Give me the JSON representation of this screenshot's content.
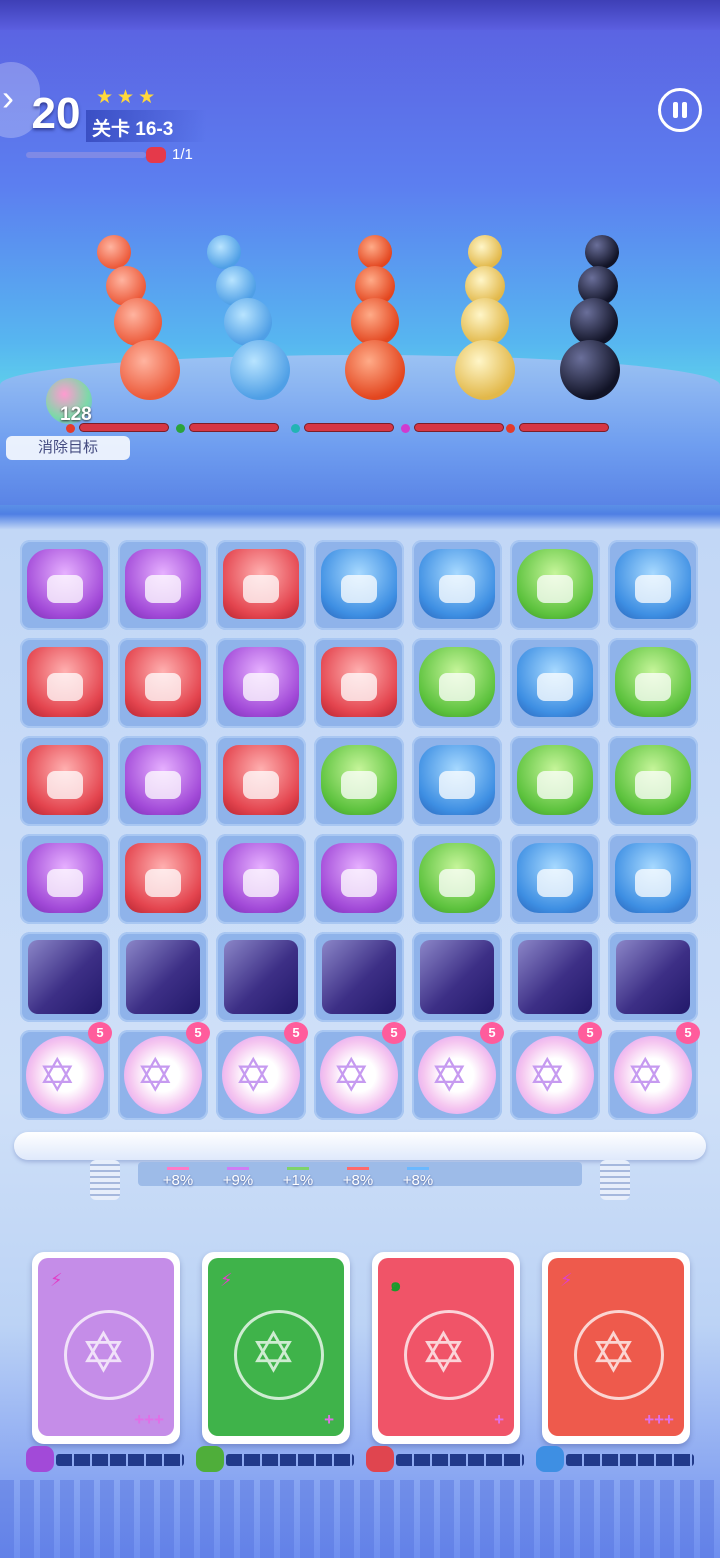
{
  "hud": {
    "moves_left": "20",
    "stars": "★★★",
    "level_label": "关卡 16-3",
    "target_progress": "1/1",
    "back_symbol": "›",
    "objective_orb_value": "128",
    "objective_button": "消除目标"
  },
  "enemies": {
    "columns": [
      "red-bird",
      "blue-jelly",
      "red-crab",
      "gold-spiky-shell",
      "black-bomb"
    ],
    "column_element_icons": [
      "fire",
      "wind",
      "ice",
      "lightning",
      "fire"
    ],
    "rows": 4
  },
  "board": {
    "rows": [
      [
        "purple",
        "purple",
        "red",
        "blue",
        "blue",
        "green",
        "blue"
      ],
      [
        "red",
        "red",
        "purple",
        "red",
        "green",
        "blue",
        "green"
      ],
      [
        "red",
        "purple",
        "red",
        "green",
        "blue",
        "green",
        "green"
      ],
      [
        "purple",
        "red",
        "purple",
        "purple",
        "green",
        "blue",
        "blue"
      ],
      [
        "dark",
        "dark",
        "dark",
        "dark",
        "dark",
        "dark",
        "dark"
      ],
      [
        "star",
        "star",
        "star",
        "star",
        "star",
        "star",
        "star"
      ]
    ],
    "star_badge": "5",
    "star_hex_symbol": "✡"
  },
  "buffs": [
    {
      "value": "+8%",
      "color": "#ff7ac8"
    },
    {
      "value": "+9%",
      "color": "#d07cf5"
    },
    {
      "value": "+1%",
      "color": "#7ed36a"
    },
    {
      "value": "+8%",
      "color": "#ff6a6a"
    },
    {
      "value": "+8%",
      "color": "#6ab8ff"
    }
  ],
  "heroes": [
    {
      "element": "⚡",
      "element_color": "#e040c8",
      "stars": "+++",
      "bg": "#c58de8",
      "energy_color": "#a24ad8"
    },
    {
      "element": "⚡",
      "element_color": "#e040c8",
      "stars": "+",
      "bg": "#3fb34a",
      "energy_color": "#4fae3a"
    },
    {
      "element": "๑",
      "element_color": "#1a9a2c",
      "stars": "+",
      "bg": "#f05468",
      "energy_color": "#e0454f"
    },
    {
      "element": "⚡",
      "element_color": "#e040c8",
      "stars": "+++",
      "bg": "#ee5a4c",
      "energy_color": "#3e8fe3"
    }
  ],
  "colors": {
    "accent": "#5b5fe0",
    "hp_bar": "#d63644",
    "star": "#ffd83a"
  }
}
